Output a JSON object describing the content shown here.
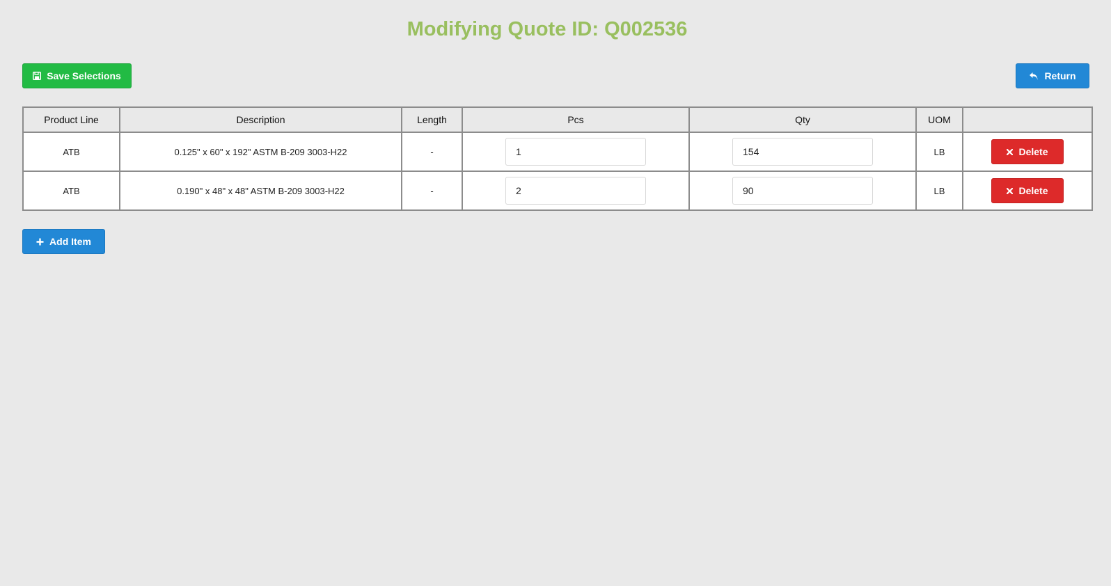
{
  "header": {
    "title": "Modifying Quote ID: Q002536"
  },
  "toolbar": {
    "save_label": "Save Selections",
    "return_label": "Return",
    "add_item_label": "Add Item"
  },
  "table": {
    "columns": [
      "Product Line",
      "Description",
      "Length",
      "Pcs",
      "Qty",
      "UOM",
      ""
    ],
    "rows": [
      {
        "product_line": "ATB",
        "description": "0.125\" x 60\" x 192\" ASTM B-209 3003-H22",
        "length": "-",
        "pcs": "1",
        "qty": "154",
        "uom": "LB",
        "delete_label": "Delete"
      },
      {
        "product_line": "ATB",
        "description": "0.190\" x 48\" x 48\" ASTM B-209 3003-H22",
        "length": "-",
        "pcs": "2",
        "qty": "90",
        "uom": "LB",
        "delete_label": "Delete"
      }
    ]
  },
  "icons": {
    "save": "floppy-disk-icon",
    "return": "undo-arrow-icon",
    "add": "plus-icon",
    "delete": "x-icon"
  },
  "colors": {
    "title": "#99bf5f",
    "save_button": "#22bb44",
    "primary_button": "#2288d6",
    "delete_button": "#dd2a2a",
    "background": "#e9e9e9"
  }
}
